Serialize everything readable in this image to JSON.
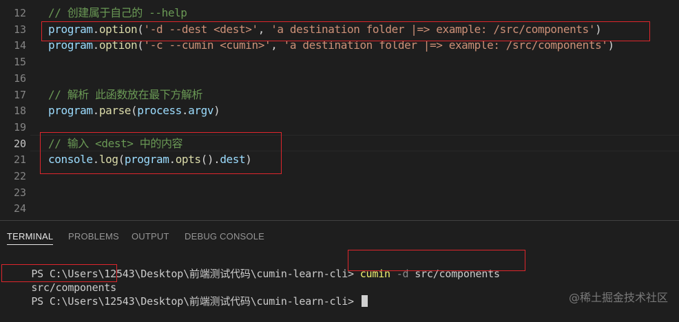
{
  "editor": {
    "lines": [
      {
        "num": "12",
        "segments": [
          {
            "cls": "cm",
            "text": "// 创建属于自己的 --help"
          }
        ]
      },
      {
        "num": "13",
        "segments": [
          {
            "cls": "var",
            "text": "program"
          },
          {
            "cls": "pn",
            "text": "."
          },
          {
            "cls": "fn",
            "text": "option"
          },
          {
            "cls": "pn",
            "text": "("
          },
          {
            "cls": "str",
            "text": "'-d --dest <dest>'"
          },
          {
            "cls": "pn",
            "text": ", "
          },
          {
            "cls": "str",
            "text": "'a destination folder |=> example: /src/components'"
          },
          {
            "cls": "pn",
            "text": ")"
          }
        ]
      },
      {
        "num": "14",
        "segments": [
          {
            "cls": "var",
            "text": "program"
          },
          {
            "cls": "pn",
            "text": "."
          },
          {
            "cls": "fn",
            "text": "option"
          },
          {
            "cls": "pn",
            "text": "("
          },
          {
            "cls": "str",
            "text": "'-c --cumin <cumin>'"
          },
          {
            "cls": "pn",
            "text": ", "
          },
          {
            "cls": "str",
            "text": "'a destination folder |=> example: /src/components'"
          },
          {
            "cls": "pn",
            "text": ")"
          }
        ]
      },
      {
        "num": "15",
        "segments": []
      },
      {
        "num": "16",
        "segments": []
      },
      {
        "num": "17",
        "segments": [
          {
            "cls": "cm",
            "text": "// 解析 此函数放在最下方解析"
          }
        ]
      },
      {
        "num": "18",
        "segments": [
          {
            "cls": "var",
            "text": "program"
          },
          {
            "cls": "pn",
            "text": "."
          },
          {
            "cls": "fn",
            "text": "parse"
          },
          {
            "cls": "pn",
            "text": "("
          },
          {
            "cls": "var",
            "text": "process"
          },
          {
            "cls": "pn",
            "text": "."
          },
          {
            "cls": "var",
            "text": "argv"
          },
          {
            "cls": "pn",
            "text": ")"
          }
        ]
      },
      {
        "num": "19",
        "segments": []
      },
      {
        "num": "20",
        "segments": [
          {
            "cls": "cm",
            "text": "// 输入 <dest> 中的内容"
          }
        ]
      },
      {
        "num": "21",
        "segments": [
          {
            "cls": "var",
            "text": "console"
          },
          {
            "cls": "pn",
            "text": "."
          },
          {
            "cls": "fn",
            "text": "log"
          },
          {
            "cls": "pn",
            "text": "("
          },
          {
            "cls": "var",
            "text": "program"
          },
          {
            "cls": "pn",
            "text": "."
          },
          {
            "cls": "fn",
            "text": "opts"
          },
          {
            "cls": "pn",
            "text": "()."
          },
          {
            "cls": "var",
            "text": "dest"
          },
          {
            "cls": "pn",
            "text": ")"
          }
        ]
      },
      {
        "num": "22",
        "segments": []
      },
      {
        "num": "23",
        "segments": []
      },
      {
        "num": "24",
        "segments": []
      }
    ],
    "active_line": "20"
  },
  "panel": {
    "tabs": [
      "TERMINAL",
      "PROBLEMS",
      "OUTPUT",
      "DEBUG CONSOLE"
    ],
    "active_tab": "TERMINAL"
  },
  "terminal": {
    "prompt1": "PS C:\\Users\\12543\\Desktop\\前端测试代码\\cumin-learn-cli>",
    "cmd": "cumin",
    "flag": "-d",
    "arg": "src/components",
    "output": "src/components",
    "prompt2": "PS C:\\Users\\12543\\Desktop\\前端测试代码\\cumin-learn-cli>"
  },
  "watermark": "@稀土掘金技术社区",
  "colors": {
    "background": "#1e1e1e",
    "highlight_box": "#e0262c",
    "comment": "#6a9955",
    "variable": "#9cdcfe",
    "function": "#dcdcaa",
    "string": "#ce9178"
  }
}
